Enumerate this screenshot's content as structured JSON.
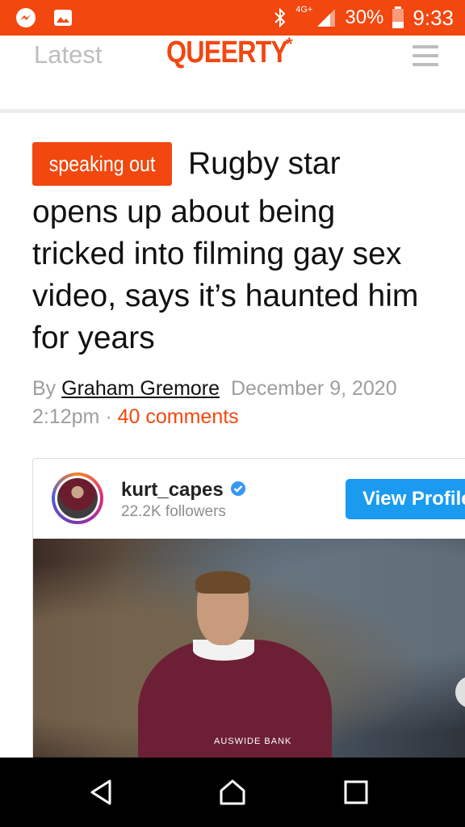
{
  "status_bar": {
    "network": "4G+",
    "battery": "30%",
    "time": "9:33",
    "icons": [
      "messenger-icon",
      "gallery-icon",
      "bluetooth-icon",
      "signal-icon",
      "battery-icon"
    ]
  },
  "header": {
    "latest_label": "Latest",
    "logo_text": "QUEERTY",
    "logo_mark": "*",
    "menu_icon": "hamburger-menu-icon"
  },
  "article": {
    "tag": "speaking out",
    "title_first_line": "Rugby star",
    "title_rest": "opens up about being tricked into filming gay sex video, says it’s haunted him for years",
    "byline_prefix": "By",
    "author": "Graham Gremore",
    "date": "December 9, 2020 2:12pm",
    "separator": "·",
    "comments": "40 comments"
  },
  "embed": {
    "username": "kurt_capes",
    "followers": "22.2K followers",
    "view_profile": "View Profile",
    "photo_sponsor_text": "AUSWIDE BANK"
  },
  "navbar": {
    "icons": [
      "back-icon",
      "home-icon",
      "recents-icon"
    ]
  },
  "colors": {
    "accent": "#f2470f",
    "button_blue": "#1a9bf0"
  }
}
